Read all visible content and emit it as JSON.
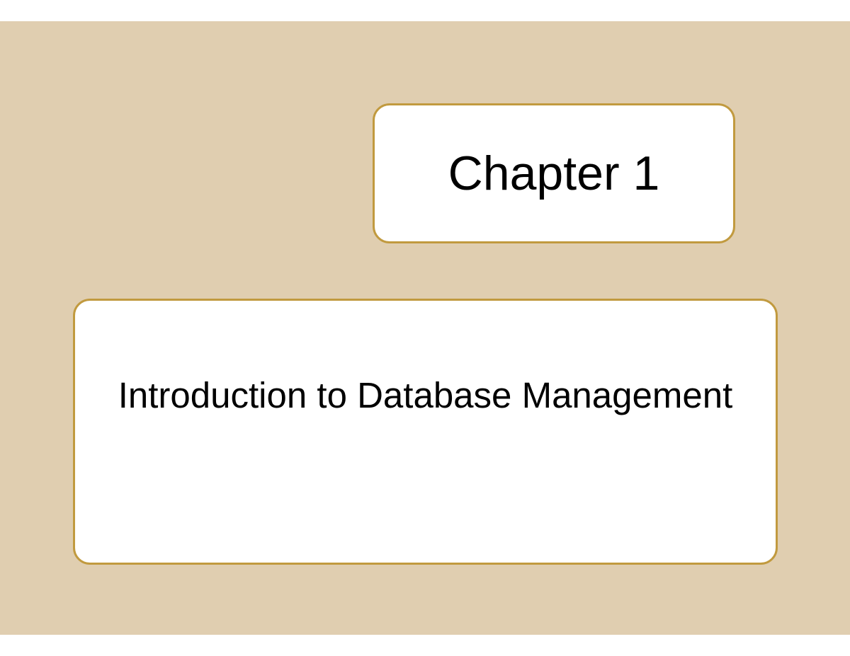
{
  "slide": {
    "chapter_title": "Chapter 1",
    "subtitle": "Introduction to Database Management"
  },
  "colors": {
    "background": "#e0ceb0",
    "box_border": "#c19a3f",
    "box_background": "#ffffff",
    "text": "#000000"
  }
}
